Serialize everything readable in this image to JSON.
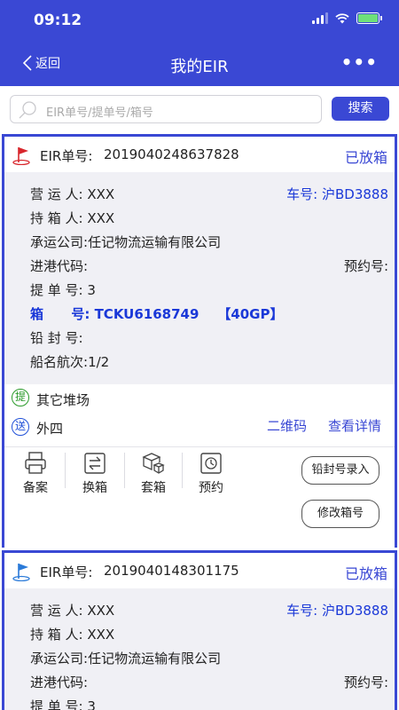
{
  "status_bar": {
    "time": "09:12"
  },
  "nav": {
    "back_label": "返回",
    "title": "我的EIR",
    "more_label": "•••"
  },
  "search": {
    "placeholder": "EIR单号/提单号/箱号",
    "button_label": "搜索"
  },
  "cards": [
    {
      "eir_label": "EIR单号:",
      "eir_number": "2019040248637828",
      "status": "已放箱",
      "flag_color": "#d8262c",
      "rows": [
        {
          "label": "营 运 人:",
          "value": "XXX",
          "right": "车号: 沪BD3888"
        },
        {
          "label": "持 箱 人:",
          "value": "XXX"
        },
        {
          "label": "承运公司:",
          "value": "任记物流运输有限公司"
        },
        {
          "label": "进港代码:",
          "value": "",
          "right": "预约号:"
        },
        {
          "label": "提 单 号:",
          "value": "3"
        },
        {
          "label": "箱      号:",
          "value": "TCKU6168749",
          "extra": "【40GP】"
        },
        {
          "label": "铅 封 号:",
          "value": ""
        },
        {
          "label": "船名航次:",
          "value": "1/2"
        }
      ],
      "pickup_badge": "提",
      "pickup_text": "其它堆场",
      "deliver_badge": "送",
      "deliver_text": "外四",
      "qr_link": "二维码",
      "detail_link": "查看详情",
      "actions": [
        "备案",
        "换箱",
        "套箱",
        "预约"
      ],
      "seal_button": "铅封号录入",
      "modify_button": "修改箱号"
    },
    {
      "eir_label": "EIR单号:",
      "eir_number": "2019040148301175",
      "status": "已放箱",
      "flag_color": "#2a7ad8",
      "rows": [
        {
          "label": "营 运 人:",
          "value": "XXX",
          "right": "车号: 沪BD3888"
        },
        {
          "label": "持 箱 人:",
          "value": "XXX"
        },
        {
          "label": "承运公司:",
          "value": "任记物流运输有限公司"
        },
        {
          "label": "进港代码:",
          "value": "",
          "right": "预约号:"
        },
        {
          "label": "提 单 号:",
          "value": "3"
        }
      ]
    }
  ],
  "colors": {
    "primary": "#3a48d4",
    "highlight_blue": "#1a38d8",
    "body_bg": "#f0f0f5"
  }
}
